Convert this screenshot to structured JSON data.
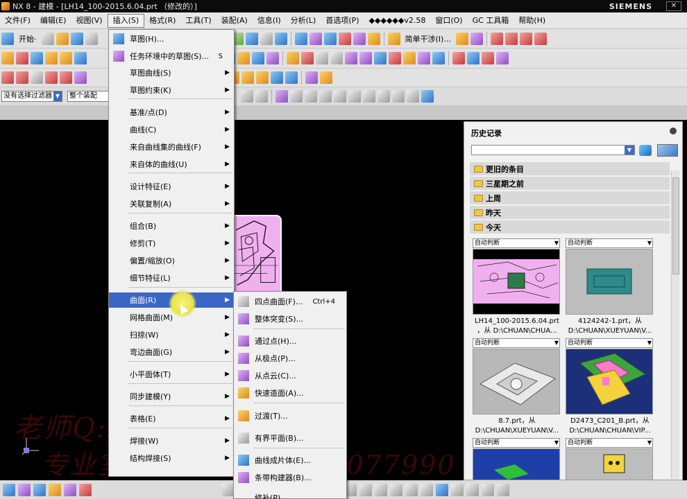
{
  "titlebar": {
    "title": "NX 8 - 建模 - [LH14_100-2015.6.04.prt （修改的）]",
    "brand": "SIEMENS"
  },
  "menubar": {
    "items": [
      "文件(F)",
      "编辑(E)",
      "视图(V)",
      "插入(S)",
      "格式(R)",
      "工具(T)",
      "装配(A)",
      "信息(I)",
      "分析(L)",
      "首选项(P)",
      "◆◆◆◆◆◆v2.58",
      "窗口(O)",
      "GC 工具箱",
      "帮助(H)"
    ]
  },
  "toolbar": {
    "start_label": "开始·",
    "simple_interference": "简单干涉(I)...",
    "filter_value": "没有选择过滤器",
    "assembly_value": "整个装配"
  },
  "insert_menu": {
    "items": [
      {
        "label": "草图(H)...",
        "shortcut": "",
        "sub": false
      },
      {
        "label": "任务环境中的草图(S)...",
        "shortcut": "S",
        "sub": false
      },
      {
        "label": "草图曲线(S)",
        "shortcut": "",
        "sub": true
      },
      {
        "label": "草图约束(K)",
        "shortcut": "",
        "sub": true
      },
      {
        "label": "基准/点(D)",
        "shortcut": "",
        "sub": true
      },
      {
        "label": "曲线(C)",
        "shortcut": "",
        "sub": true
      },
      {
        "label": "来自曲线集的曲线(F)",
        "shortcut": "",
        "sub": true
      },
      {
        "label": "来自体的曲线(U)",
        "shortcut": "",
        "sub": true
      },
      {
        "label": "设计特征(E)",
        "shortcut": "",
        "sub": true
      },
      {
        "label": "关联复制(A)",
        "shortcut": "",
        "sub": true
      },
      {
        "label": "组合(B)",
        "shortcut": "",
        "sub": true
      },
      {
        "label": "修剪(T)",
        "shortcut": "",
        "sub": true
      },
      {
        "label": "偏置/缩放(O)",
        "shortcut": "",
        "sub": true
      },
      {
        "label": "细节特征(L)",
        "shortcut": "",
        "sub": true
      },
      {
        "label": "曲面(R)",
        "shortcut": "",
        "sub": true
      },
      {
        "label": "网格曲面(M)",
        "shortcut": "",
        "sub": true
      },
      {
        "label": "扫掠(W)",
        "shortcut": "",
        "sub": true
      },
      {
        "label": "弯边曲面(G)",
        "shortcut": "",
        "sub": true
      },
      {
        "label": "小平面体(T)",
        "shortcut": "",
        "sub": true
      },
      {
        "label": "同步建模(Y)",
        "shortcut": "",
        "sub": true
      },
      {
        "label": "表格(E)",
        "shortcut": "",
        "sub": true
      },
      {
        "label": "焊接(W)",
        "shortcut": "",
        "sub": true
      },
      {
        "label": "结构焊接(S)",
        "shortcut": "",
        "sub": true
      }
    ]
  },
  "surface_menu": {
    "items": [
      {
        "label": "四点曲面(F)...",
        "shortcut": "Ctrl+4"
      },
      {
        "label": "整体突变(S)...",
        "shortcut": ""
      },
      {
        "label": "通过点(H)...",
        "shortcut": ""
      },
      {
        "label": "从极点(P)...",
        "shortcut": ""
      },
      {
        "label": "从点云(C)...",
        "shortcut": ""
      },
      {
        "label": "快速造面(A)...",
        "shortcut": ""
      },
      {
        "label": "过渡(T)...",
        "shortcut": ""
      },
      {
        "label": "有界平面(B)...",
        "shortcut": ""
      },
      {
        "label": "曲线成片体(E)...",
        "shortcut": ""
      },
      {
        "label": "条带构建器(B)...",
        "shortcut": ""
      },
      {
        "label": "修补(P)...",
        "shortcut": ""
      }
    ]
  },
  "history": {
    "title": "历史记录",
    "groups": [
      "更旧的条目",
      "三星期之前",
      "上周",
      "昨天",
      "今天"
    ],
    "cards": [
      {
        "dd": "自动判断",
        "name": "LH14_100-2015.6.04.prt",
        "path": "，从 D:\\CHUAN\\CHUA..."
      },
      {
        "dd": "自动判断",
        "name": "4124242-1.prt，从",
        "path": "D:\\CHUAN\\XUEYUAN\\V..."
      },
      {
        "dd": "自动判断",
        "name": "8.7.prt，从",
        "path": "D:\\CHUAN\\XUEYUAN\\V..."
      },
      {
        "dd": "自动判断",
        "name": "D2473_C201_B.prt，从",
        "path": "D:\\CHUAN\\CHUAN\\VIP..."
      },
      {
        "dd": "自动判断",
        "name": "",
        "path": ""
      },
      {
        "dd": "自动判断",
        "name": "",
        "path": ""
      }
    ]
  },
  "watermark": {
    "line1": "老师Q:2977373512",
    "line2": "专业室内设计视频:5219077990"
  }
}
